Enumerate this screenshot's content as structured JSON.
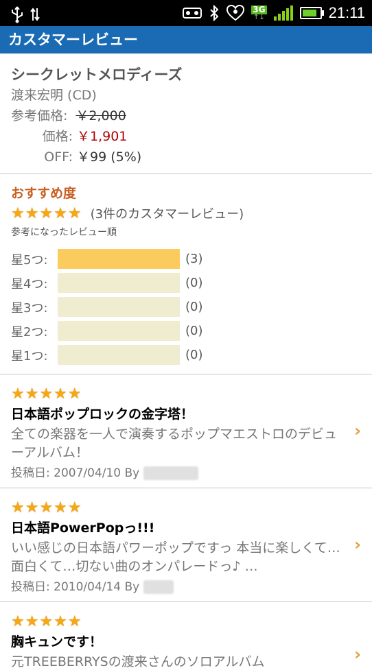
{
  "status_bar": {
    "time": "21:11",
    "network": "3G"
  },
  "title_bar": {
    "title": "カスタマーレビュー"
  },
  "product": {
    "title": "シークレットメロディーズ",
    "artist": "渡来宏明 (CD)",
    "ref_price_label": "参考価格:",
    "ref_price": "￥2,000",
    "price_label": "価格:",
    "price": "￥1,901",
    "off_label": "OFF:",
    "off_value": "￥99 (5%)"
  },
  "rating": {
    "heading": "おすすめ度",
    "stars": "★★★★★",
    "count_text": "(3件のカスタマーレビュー)",
    "sort_label": "参考になったレビュー順",
    "bars": [
      {
        "label": "星5つ:",
        "count": "(3)",
        "fraction": 1.0
      },
      {
        "label": "星4つ:",
        "count": "(0)",
        "fraction": 0
      },
      {
        "label": "星3つ:",
        "count": "(0)",
        "fraction": 0
      },
      {
        "label": "星2つ:",
        "count": "(0)",
        "fraction": 0
      },
      {
        "label": "星1つ:",
        "count": "(0)",
        "fraction": 0
      }
    ]
  },
  "reviews": [
    {
      "stars": "★★★★★",
      "title": "日本語ポップロックの金字塔！",
      "body": "全ての楽器を一人で演奏するポップマエストロのデビューアルバム！",
      "meta": "投稿日: 2007/04/10 By"
    },
    {
      "stars": "★★★★★",
      "title": "日本語PowerPopっ!!!",
      "body": "いい感じの日本語パワーポップですっ 本当に楽しくて…面白くて…切ない曲のオンパレードっ♪ …",
      "meta": "投稿日: 2010/04/14 By"
    },
    {
      "stars": "★★★★★",
      "title": "胸キュンです！",
      "body": "元TREEBERRYSの渡来さんのソロアルバム"
    }
  ],
  "colors": {
    "title_bar": "#1a6bb3",
    "accent": "#c85e20",
    "star": "#f6a713",
    "price": "#b00000"
  }
}
